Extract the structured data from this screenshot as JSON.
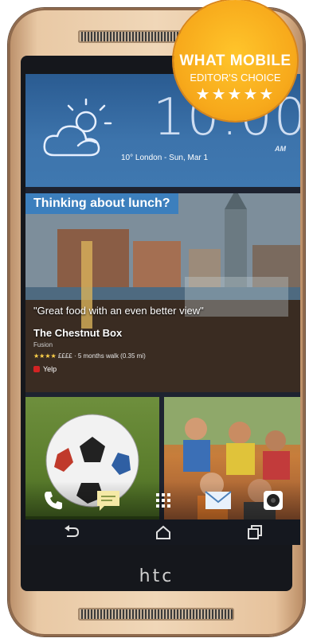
{
  "badge": {
    "line1": "WHAT MOBILE",
    "line2": "EDITOR'S CHOICE",
    "stars": "★★★★★"
  },
  "clock": {
    "time": "10:00",
    "ampm": "AM",
    "weather_line": "10° London - Sun, Mar 1"
  },
  "feed": {
    "header": "Thinking about lunch?",
    "quote": "\"Great food with an even better view\"",
    "venue": "The Chestnut Box",
    "cuisine": "Fusion",
    "rating_stars": "★★★★",
    "meta": "££££ · 5 months walk (0.35 mi)",
    "source": "Yelp"
  },
  "dock": [
    "phone-icon",
    "messages-icon",
    "app-drawer-icon",
    "mail-icon",
    "camera-icon"
  ],
  "nav": [
    "back-icon",
    "home-icon",
    "recents-icon"
  ],
  "brand": "htc",
  "colors": {
    "badge": "#f7a91b",
    "feed_header": "#3c7fbd",
    "clock_bg": "#3d74ac",
    "phone_gold": "#e9c9a5"
  }
}
